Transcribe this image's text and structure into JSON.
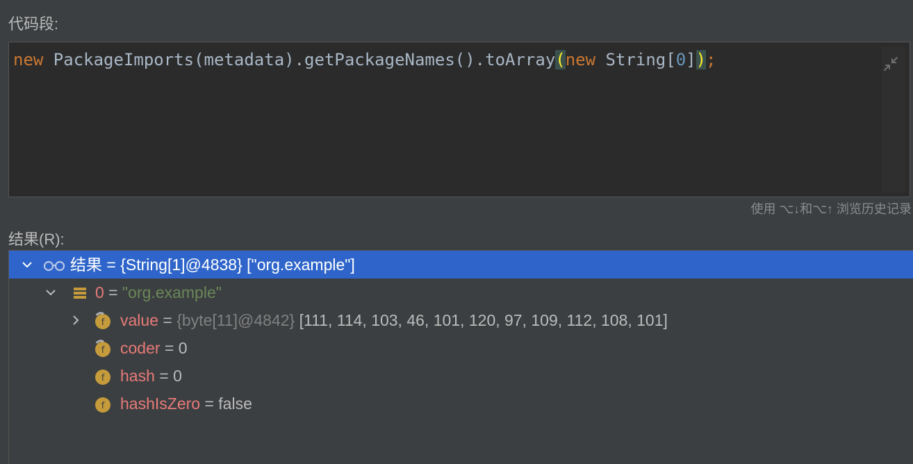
{
  "snippet_label": "代码段:",
  "code": {
    "kw_new": "new",
    "part1": " PackageImports(metadata).getPackageNames().toArray",
    "paren_open": "(",
    "kw_new2": "new",
    "part2": " String[",
    "index": "0",
    "part3": "]",
    "paren_close": ")",
    "semicolon": ";"
  },
  "history_hint": "使用 ⌥↓和⌥↑ 浏览历史记录",
  "result_label": "结果(R):",
  "tree": {
    "root": "结果 = {String[1]@4838} [\"org.example\"]",
    "item0": {
      "name": "0",
      "eq": " = ",
      "value": "\"org.example\""
    },
    "value": {
      "name": "value",
      "eq": " = ",
      "ref": "{byte[11]@4842}",
      "data": " [111, 114, 103, 46, 101, 120, 97, 109, 112, 108, 101]"
    },
    "coder": {
      "name": "coder",
      "rest": " = 0"
    },
    "hash": {
      "name": "hash",
      "rest": " = 0"
    },
    "hashIsZero": {
      "name": "hashIsZero",
      "rest": " = false"
    }
  },
  "colors": {
    "background": "#3c3f41",
    "editor_bg": "#2b2b2b",
    "selection": "#2f65ca",
    "field_name": "#e87a79",
    "string_value": "#6a8759",
    "keyword": "#cc7832",
    "field_icon": "#c59b3b"
  }
}
